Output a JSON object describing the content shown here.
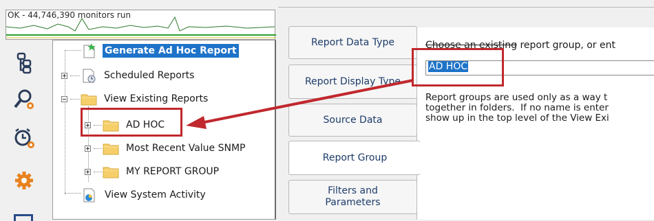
{
  "status_graph": {
    "text": "OK - 44,746,390 monitors run"
  },
  "sidebar_icons": [
    "hierarchy-icon",
    "magnify-gear-icon",
    "alarm-clock-gear-icon",
    "gear-icon"
  ],
  "tree": {
    "items": [
      {
        "label": "Generate Ad Hoc Report",
        "icon": "document-new-icon"
      },
      {
        "label": "Scheduled Reports",
        "icon": "scheduled-document-icon"
      },
      {
        "label": "View Existing Reports",
        "icon": "folder-icon"
      },
      {
        "label": "AD HOC",
        "icon": "folder-icon"
      },
      {
        "label": "Most Recent Value SNMP",
        "icon": "folder-icon"
      },
      {
        "label": "MY REPORT GROUP",
        "icon": "folder-icon"
      },
      {
        "label": "View System Activity",
        "icon": "activity-icon"
      }
    ]
  },
  "tabs": [
    {
      "label": "Report Data Type"
    },
    {
      "label": "Report Display Type"
    },
    {
      "label": "Source Data"
    },
    {
      "label": "Report Group"
    },
    {
      "label": "Filters and Parameters"
    }
  ],
  "content": {
    "prompt_struck": "Choose an existing",
    "prompt_rest": " report group, or ent",
    "group_value": "AD HOC",
    "help_text": "Report groups are used only as a way t\ntogether in folders.  If no name is enter\nshow up in the top level of the View Exi"
  },
  "colors": {
    "selection": "#1e73c8",
    "annotation": "#c0282d",
    "tab_text": "#1d3c6a"
  }
}
